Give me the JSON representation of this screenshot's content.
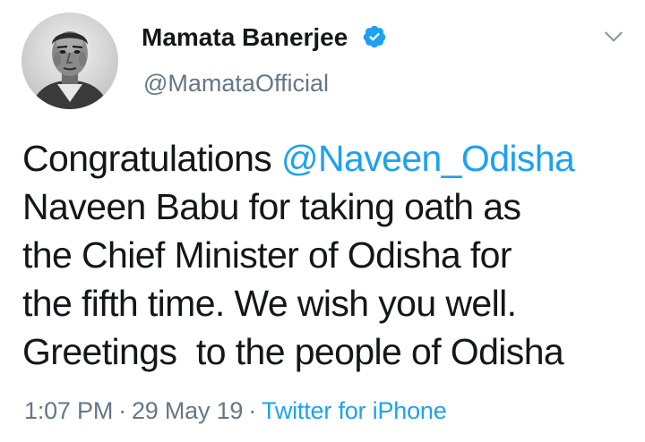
{
  "user": {
    "display_name": "Mamata Banerjee",
    "handle": "@MamataOfficial",
    "verified": true
  },
  "icons": {
    "verified": "verified-badge-icon",
    "menu": "chevron-down-icon"
  },
  "tweet": {
    "lines": [
      {
        "text_before": "Congratulations ",
        "mention": "@Naveen_Odisha",
        "text_after": ""
      },
      {
        "text": "Naveen Babu for taking oath as"
      },
      {
        "text": "the Chief Minister of Odisha for"
      },
      {
        "text": "the fifth time. We wish you well."
      },
      {
        "text": "Greetings  to the people of Odisha"
      }
    ]
  },
  "meta": {
    "time": "1:07 PM",
    "separator": "·",
    "date": "29 May 19",
    "source": "Twitter for iPhone"
  },
  "colors": {
    "link": "#1da1f2",
    "text": "#14171a",
    "secondary": "#657786"
  }
}
